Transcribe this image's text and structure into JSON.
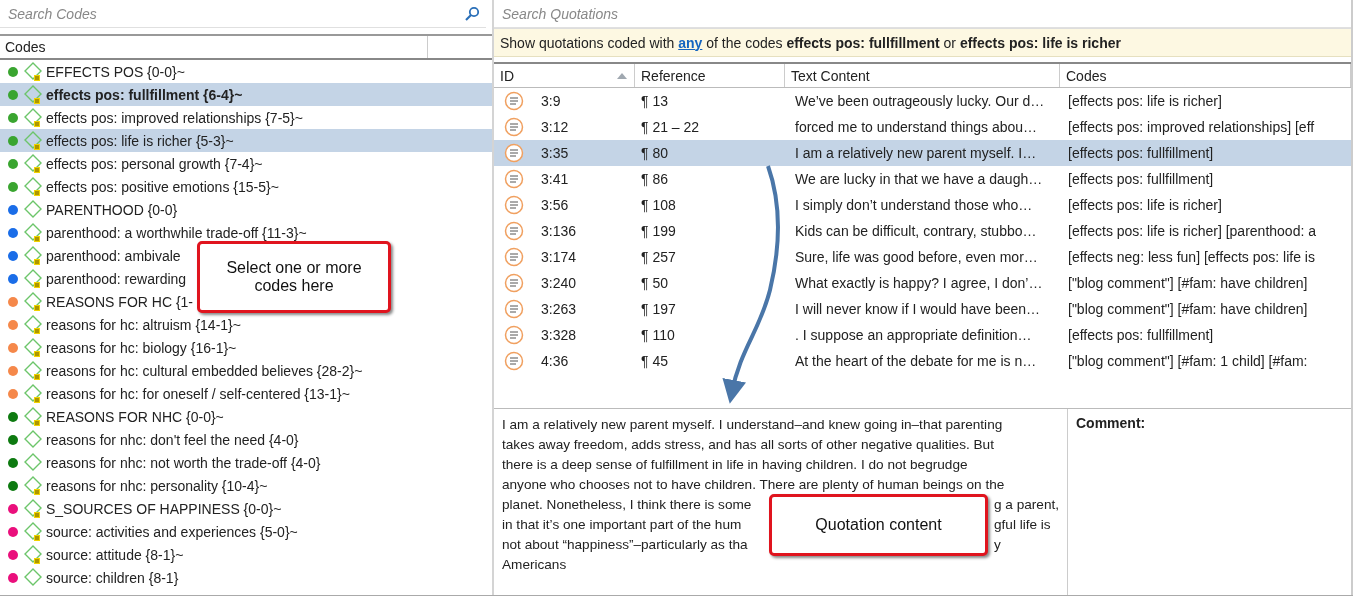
{
  "codes_panel": {
    "search": {
      "placeholder": "Search Codes"
    },
    "column": "Codes",
    "items": [
      {
        "label": "EFFECTS POS {0-0}~",
        "color": "#3aa530",
        "memo": true,
        "selected": false,
        "focused": false
      },
      {
        "label": "effects pos: fullfillment {6-4}~",
        "color": "#3aa530",
        "memo": true,
        "selected": true,
        "focused": true
      },
      {
        "label": "effects pos: improved relationships {7-5}~",
        "color": "#3aa530",
        "memo": true,
        "selected": false,
        "focused": false
      },
      {
        "label": "effects pos: life is richer {5-3}~",
        "color": "#3aa530",
        "memo": true,
        "selected": true,
        "focused": false
      },
      {
        "label": "effects pos: personal growth {7-4}~",
        "color": "#3aa530",
        "memo": true,
        "selected": false,
        "focused": false
      },
      {
        "label": "effects pos: positive emotions {15-5}~",
        "color": "#3aa530",
        "memo": true,
        "selected": false,
        "focused": false
      },
      {
        "label": "PARENTHOOD {0-0}",
        "color": "#1a6de8",
        "memo": false,
        "selected": false,
        "focused": false
      },
      {
        "label": "parenthood: a worthwhile trade-off {11-3}~",
        "color": "#1a6de8",
        "memo": true,
        "selected": false,
        "focused": false
      },
      {
        "label": "parenthood: ambivale",
        "color": "#1a6de8",
        "memo": true,
        "selected": false,
        "focused": false
      },
      {
        "label": "parenthood: rewarding",
        "color": "#1a6de8",
        "memo": true,
        "selected": false,
        "focused": false
      },
      {
        "label": "REASONS FOR HC {1-",
        "color": "#f5884a",
        "memo": true,
        "selected": false,
        "focused": false
      },
      {
        "label": "reasons for hc: altruism {14-1}~",
        "color": "#f5884a",
        "memo": true,
        "selected": false,
        "focused": false
      },
      {
        "label": "reasons for hc: biology {16-1}~",
        "color": "#f5884a",
        "memo": true,
        "selected": false,
        "focused": false
      },
      {
        "label": "reasons for hc: cultural embedded believes {28-2}~",
        "color": "#f5884a",
        "memo": true,
        "selected": false,
        "focused": false
      },
      {
        "label": "reasons for hc: for oneself / self-centered {13-1}~",
        "color": "#f5884a",
        "memo": true,
        "selected": false,
        "focused": false
      },
      {
        "label": "REASONS FOR NHC {0-0}~",
        "color": "#0d7a10",
        "memo": true,
        "selected": false,
        "focused": false
      },
      {
        "label": "reasons for nhc: don't feel the need {4-0}",
        "color": "#0d7a10",
        "memo": false,
        "selected": false,
        "focused": false
      },
      {
        "label": "reasons for nhc: not worth the trade-off {4-0}",
        "color": "#0d7a10",
        "memo": false,
        "selected": false,
        "focused": false
      },
      {
        "label": "reasons for nhc: personality {10-4}~",
        "color": "#0d7a10",
        "memo": true,
        "selected": false,
        "focused": false
      },
      {
        "label": "S_SOURCES OF HAPPINESS {0-0}~",
        "color": "#ea0f7c",
        "memo": true,
        "selected": false,
        "focused": false
      },
      {
        "label": "source: activities and experiences {5-0}~",
        "color": "#ea0f7c",
        "memo": true,
        "selected": false,
        "focused": false
      },
      {
        "label": "source: attitude {8-1}~",
        "color": "#ea0f7c",
        "memo": true,
        "selected": false,
        "focused": false
      },
      {
        "label": "source: children {8-1}",
        "color": "#ea0f7c",
        "memo": false,
        "selected": false,
        "focused": false
      }
    ],
    "callout": "Select one or more codes here"
  },
  "quotations_panel": {
    "search": {
      "placeholder": "Search Quotations"
    },
    "filter": {
      "prefix": "Show quotations coded with",
      "link": "any",
      "suffix": "of the codes **effects pos: fullfillment** or **effects pos: life is richer**"
    },
    "table": {
      "columns": [
        "ID",
        "Reference",
        "Text Content",
        "Codes"
      ],
      "rows": [
        {
          "id": "3:9",
          "reference": "¶ 13",
          "text": "We’ve been outrageously lucky. Our d…",
          "codes": "[effects pos: life is richer]",
          "selected": false
        },
        {
          "id": "3:12",
          "reference": "¶ 21 – 22",
          "text": "forced me to understand things abou…",
          "codes": "[effects pos: improved relationships] [eff",
          "selected": false
        },
        {
          "id": "3:35",
          "reference": "¶ 80",
          "text": "I am a relatively new parent myself. I…",
          "codes": "[effects pos: fullfillment]",
          "selected": true
        },
        {
          "id": "3:41",
          "reference": "¶ 86",
          "text": "We are lucky in that we have a daugh…",
          "codes": "[effects pos: fullfillment]",
          "selected": false
        },
        {
          "id": "3:56",
          "reference": "¶ 108",
          "text": "I simply don’t understand those who…",
          "codes": "[effects pos: life is richer]",
          "selected": false
        },
        {
          "id": "3:136",
          "reference": "¶ 199",
          "text": "Kids can be difficult, contrary, stubbo…",
          "codes": "[effects pos: life is richer] [parenthood: a",
          "selected": false
        },
        {
          "id": "3:174",
          "reference": "¶ 257",
          "text": "Sure, life was good before, even mor…",
          "codes": "[effects neg: less fun] [effects pos: life is",
          "selected": false
        },
        {
          "id": "3:240",
          "reference": "¶ 50",
          "text": "What exactly is happy? I agree, I don’…",
          "codes": "[\"blog comment\"] [#fam: have children]",
          "selected": false
        },
        {
          "id": "3:263",
          "reference": "¶ 197",
          "text": "I will never know if I would have been…",
          "codes": "[\"blog comment\"] [#fam: have children]",
          "selected": false
        },
        {
          "id": "3:328",
          "reference": "¶ 110",
          "text": ". I suppose an appropriate definition…",
          "codes": "[effects pos: fullfillment]",
          "selected": false
        },
        {
          "id": "4:36",
          "reference": "¶ 45",
          "text": "At the heart of the debate for me is n…",
          "codes": "[\"blog comment\"] [#fam: 1 child] [#fam:",
          "selected": false
        }
      ]
    },
    "content": {
      "lines": [
        {
          "left": "I am a relatively new parent myself. I understand–and knew going in–that parenting"
        },
        {
          "left": "takes away freedom, adds stress, and has all sorts of other negative qualities. But"
        },
        {
          "left": "there is a deep sense of fulfillment in life in having children. I do not begrudge"
        },
        {
          "left": "anyone who chooses not to have children. There are plenty of human beings on the"
        },
        {
          "left": "planet. Nonetheless, I think there is some",
          "right": "g a parent,"
        },
        {
          "left": "in that it’s one important part of the hum",
          "right": "gful life is"
        },
        {
          "left": "not about “happiness”–particularly as tha",
          "right": "y"
        },
        {
          "left": "Americans"
        }
      ],
      "comment_label": "Comment:",
      "callout": "Quotation content"
    }
  }
}
